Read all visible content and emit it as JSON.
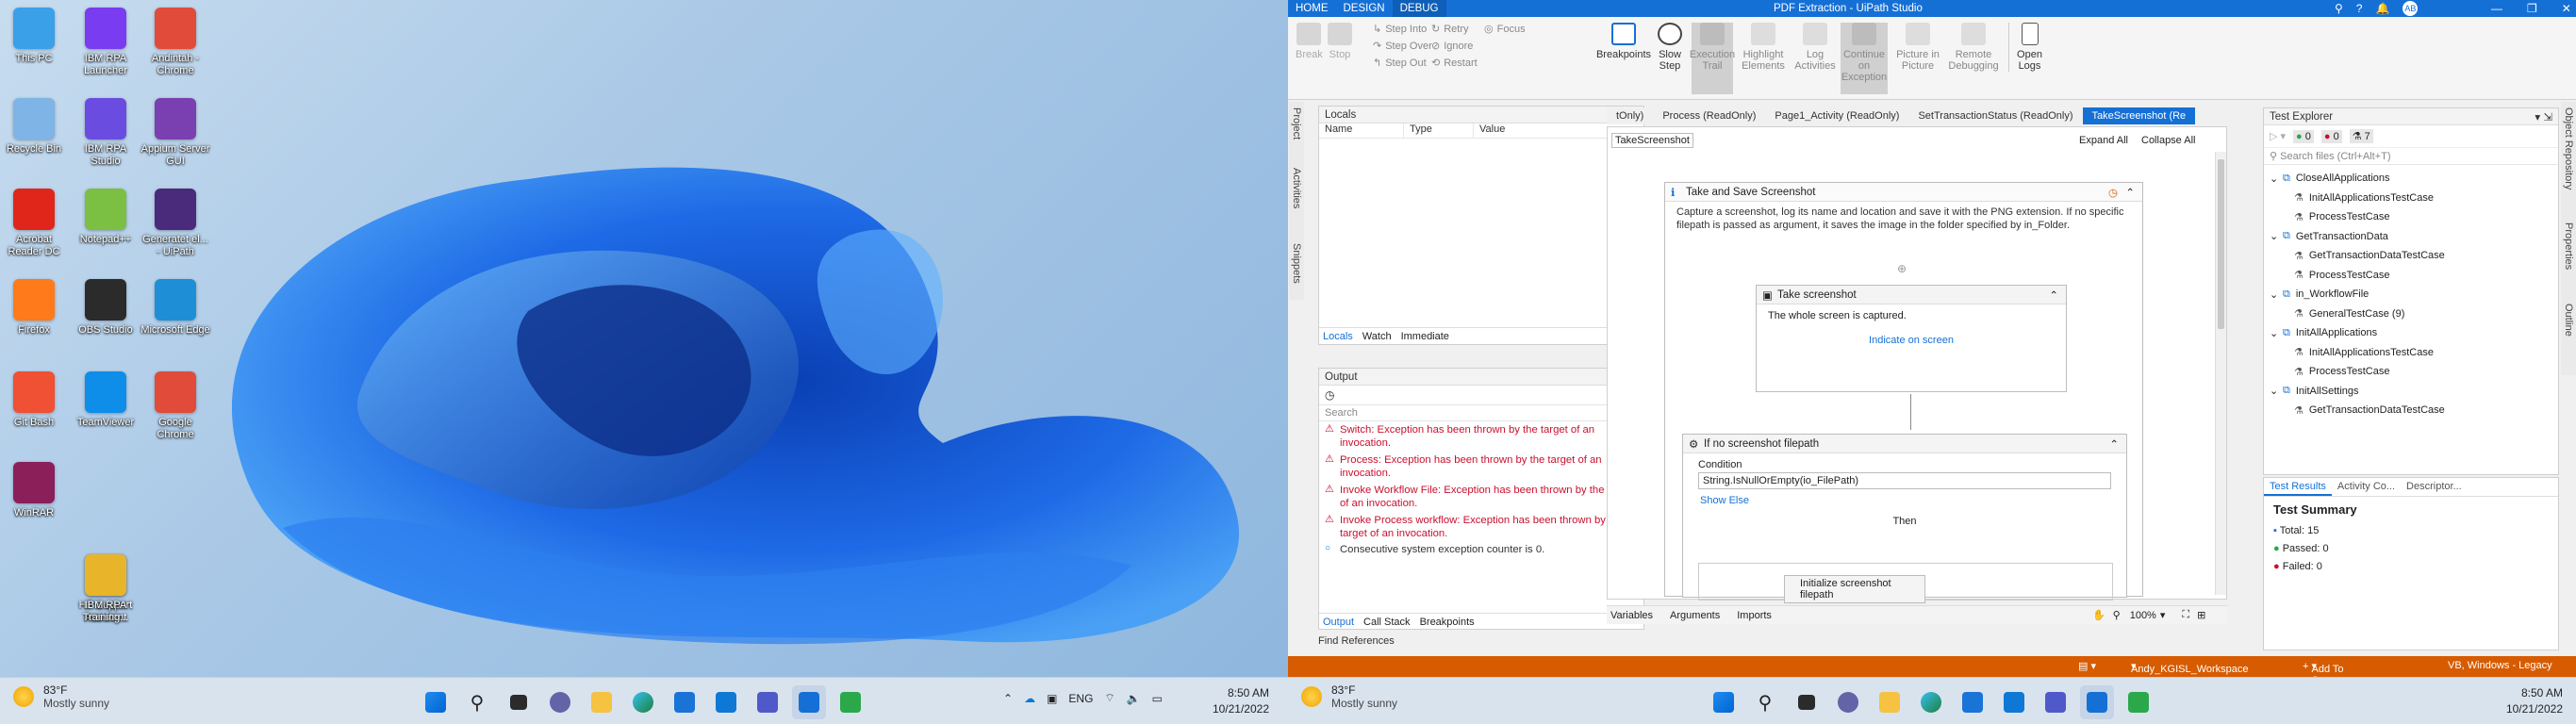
{
  "desktop": {
    "icons": [
      {
        "label": "This PC",
        "color": "#3aa0e8"
      },
      {
        "label": "IBM RPA Launcher",
        "color": "#7a3cf0"
      },
      {
        "label": "Andintah - Chrome",
        "color": "#e04b3a"
      },
      {
        "label": "Recycle Bin",
        "color": "#7fb4e6"
      },
      {
        "label": "IBM RPA Studio",
        "color": "#6a4de0"
      },
      {
        "label": "Appium Server GUI",
        "color": "#7a3fb0"
      },
      {
        "label": "Acrobat Reader DC",
        "color": "#e0261b"
      },
      {
        "label": "Notepad++",
        "color": "#7bc043"
      },
      {
        "label": "Generatet el... - UiPath",
        "color": "#4a2a7a"
      },
      {
        "label": "Firefox",
        "color": "#ff7a1a"
      },
      {
        "label": "OBS Studio",
        "color": "#2b2b2b"
      },
      {
        "label": "Microsoft Edge",
        "color": "#1e8fd6"
      },
      {
        "label": "Git Bash",
        "color": "#f05033"
      },
      {
        "label": "TeamViewer",
        "color": "#0e8ee9"
      },
      {
        "label": "Google Chrome",
        "color": "#e04b3a"
      },
      {
        "label": "WinRAR",
        "color": "#8b1f5a"
      },
      {
        "label": "HP Support Assistant",
        "color": "#1a8fe0"
      },
      {
        "label": "IBM RPA Training...",
        "color": "#e8b52a"
      }
    ]
  },
  "taskbar_left": {
    "weather_temp": "83°F",
    "weather_desc": "Mostly sunny",
    "lang": "ENG",
    "time": "8:50 AM",
    "date": "10/21/2022"
  },
  "taskbar_right": {
    "weather_temp": "83°F",
    "weather_desc": "Mostly sunny",
    "time": "8:50 AM",
    "date": "10/21/2022"
  },
  "studio": {
    "tabs": [
      "HOME",
      "DESIGN",
      "DEBUG"
    ],
    "title": "PDF Extraction - UiPath Studio",
    "avatar": "AB",
    "ribbon": {
      "break": "Break",
      "stop": "Stop",
      "step_into": "Step Into",
      "step_over": "Step Over",
      "step_out": "Step Out",
      "retry": "Retry",
      "ignore": "Ignore",
      "restart": "Restart",
      "focus": "Focus",
      "breakpoints": "Breakpoints",
      "slow_step": "Slow Step",
      "execution_trail": "Execution Trail",
      "highlight_elements": "Highlight Elements",
      "log_activities": "Log Activities",
      "continue_on_exception": "Continue on Exception",
      "picture_in_picture": "Picture in Picture",
      "remote_debugging": "Remote Debugging",
      "open_logs": "Open Logs"
    },
    "side_tabs": [
      "Project",
      "Activities",
      "Snippets"
    ],
    "locals": {
      "title": "Locals",
      "columns": [
        "Name",
        "Type",
        "Value"
      ],
      "tabs": [
        "Locals",
        "Watch",
        "Immediate"
      ]
    },
    "output": {
      "title": "Output",
      "search_placeholder": "Search",
      "messages": [
        {
          "kind": "error",
          "text": "Switch: Exception has been thrown by the target of an invocation."
        },
        {
          "kind": "error",
          "text": "Process: Exception has been thrown by the target of an invocation."
        },
        {
          "kind": "error",
          "text": "Invoke Workflow File: Exception has been thrown by the target of an invocation."
        },
        {
          "kind": "error",
          "text": "Invoke Process workflow: Exception has been thrown by the target of an invocation."
        },
        {
          "kind": "info",
          "text": "Consecutive system exception counter is 0."
        }
      ],
      "tabs": [
        "Output",
        "Call Stack",
        "Breakpoints"
      ],
      "find_references": "Find References"
    },
    "doc_tabs": [
      "tOnly)",
      "Process (ReadOnly)",
      "Page1_Activity (ReadOnly)",
      "SetTransactionStatus (ReadOnly)",
      "TakeScreenshot (Re"
    ],
    "designer": {
      "breadcrumb": "TakeScreenshot",
      "expand_all": "Expand All",
      "collapse_all": "Collapse All",
      "seq_title": "Take and Save Screenshot",
      "seq_desc": "Capture a screenshot, log its name and location and save it with the PNG extension. If no specific filepath is passed as argument, it saves the image in the folder specified by in_Folder.",
      "take_title": "Take screenshot",
      "take_desc": "The whole screen is captured.",
      "indicate": "Indicate on screen",
      "if_title": "If no screenshot filepath",
      "condition_label": "Condition",
      "condition_value": "String.IsNullOrEmpty(io_FilePath)",
      "show_else": "Show Else",
      "then": "Then",
      "init": "Initialize screenshot filepath",
      "bottom_tabs": [
        "Variables",
        "Arguments",
        "Imports"
      ],
      "zoom": "100%"
    },
    "test_explorer": {
      "title": "Test Explorer",
      "passed_count": "0",
      "failed_count": "0",
      "total_count": "7",
      "search_placeholder": "Search files (Ctrl+Alt+T)",
      "tree": [
        {
          "level": 0,
          "label": "CloseAllApplications"
        },
        {
          "level": 1,
          "label": "InitAllApplicationsTestCase"
        },
        {
          "level": 1,
          "label": "ProcessTestCase"
        },
        {
          "level": 0,
          "label": "GetTransactionData"
        },
        {
          "level": 1,
          "label": "GetTransactionDataTestCase"
        },
        {
          "level": 1,
          "label": "ProcessTestCase"
        },
        {
          "level": 0,
          "label": "in_WorkflowFile"
        },
        {
          "level": 1,
          "label": "GeneralTestCase (9)"
        },
        {
          "level": 0,
          "label": "InitAllApplications"
        },
        {
          "level": 1,
          "label": "InitAllApplicationsTestCase"
        },
        {
          "level": 1,
          "label": "ProcessTestCase"
        },
        {
          "level": 0,
          "label": "InitAllSettings"
        },
        {
          "level": 1,
          "label": "GetTransactionDataTestCase"
        }
      ],
      "bottom_tabs": [
        "Test Results",
        "Activity Co...",
        "Descriptor..."
      ],
      "summary_title": "Test Summary",
      "total": "Total: 15",
      "passed": "Passed: 0",
      "failed": "Failed: 0"
    },
    "right_side_tabs": [
      "Object Repository",
      "Properties",
      "Outline"
    ],
    "status": {
      "workspace": "Andy_KGISL_Workspace",
      "source_control": "Add To Source Control",
      "framework": "VB, Windows - Legacy"
    }
  }
}
